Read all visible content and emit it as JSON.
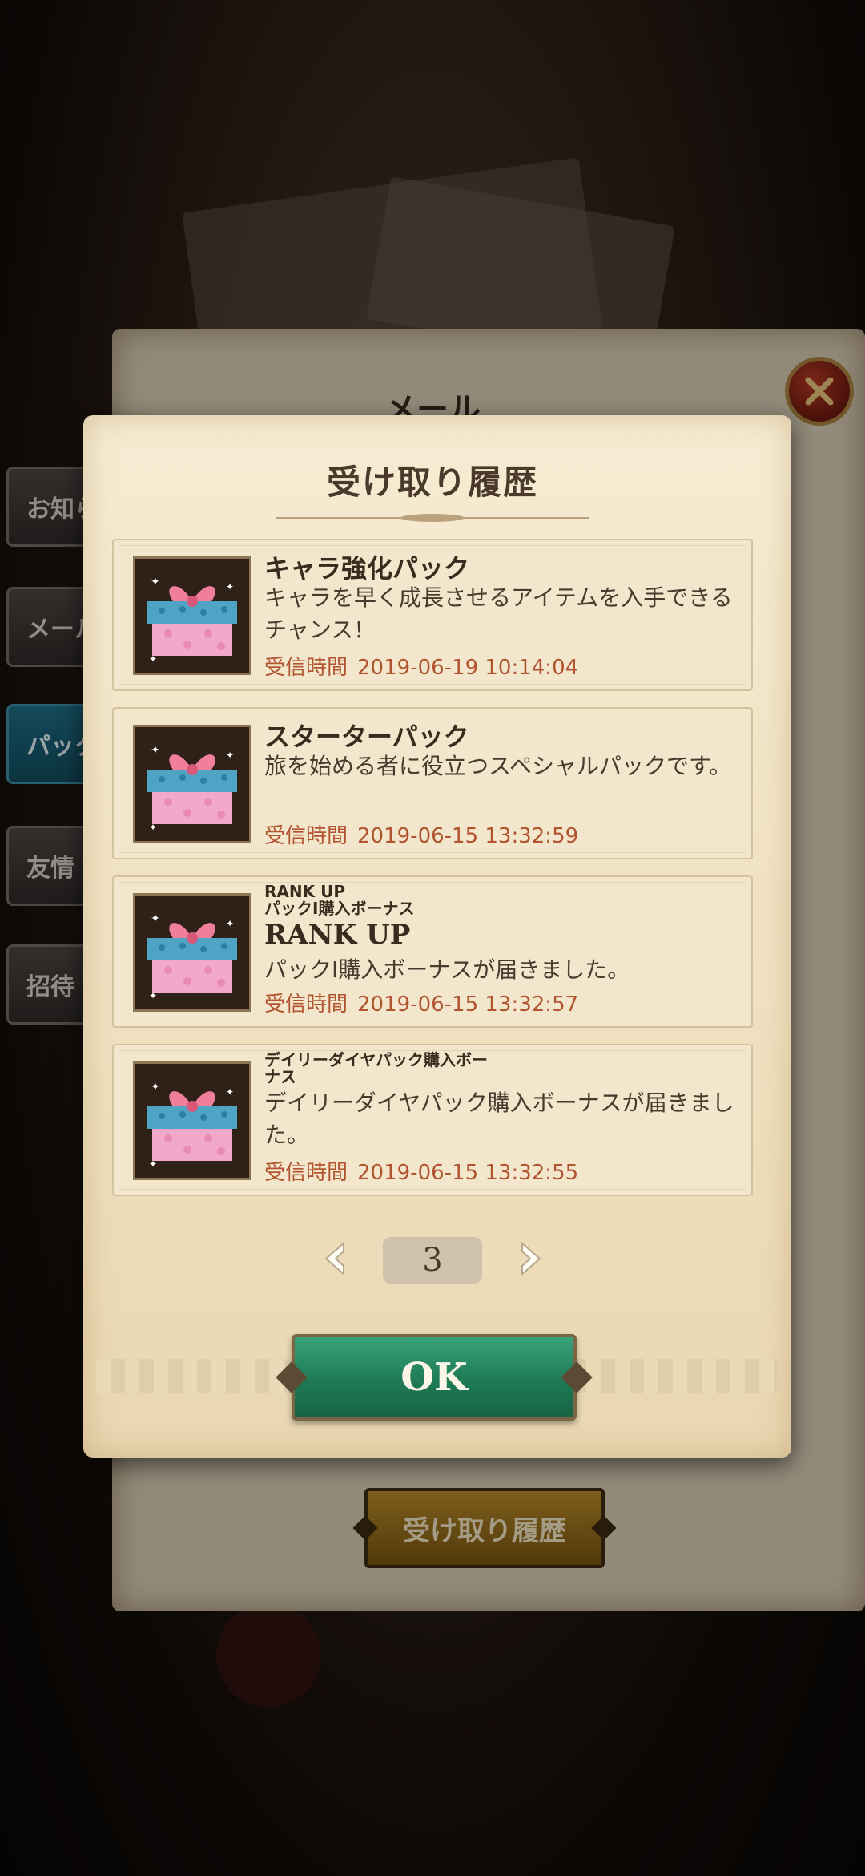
{
  "background": {
    "mail_window_title": "メール",
    "side_tabs": [
      {
        "label": "お知らせ",
        "active": false
      },
      {
        "label": "メール",
        "active": false
      },
      {
        "label": "パック",
        "active": true
      },
      {
        "label": "友情",
        "active": false
      },
      {
        "label": "招待",
        "active": false
      }
    ],
    "history_button_label": "受け取り履歴"
  },
  "modal": {
    "title": "受け取り履歴",
    "time_label": "受信時間",
    "items": [
      {
        "title": "キャラ強化パック",
        "description": "キャラを早く成長させるアイテムを入手できるチャンス！",
        "received": "2019-06-19 10:14:04",
        "icon": "gift-box-icon"
      },
      {
        "title": "スターターパック",
        "description": "旅を始める者に役立つスペシャルパックです。",
        "received": "2019-06-15 13:32:59",
        "icon": "gift-box-icon"
      },
      {
        "small_title": "RANK UP\nパックⅠ購入ボーナス",
        "big_title": "RANK UP",
        "description": "パックⅠ購入ボーナスが届きました。",
        "received": "2019-06-15 13:32:57",
        "icon": "gift-box-icon"
      },
      {
        "small_title": "デイリーダイヤパック購入ボーナス",
        "description": "デイリーダイヤパック購入ボーナスが届きました。",
        "received": "2019-06-15 13:32:55",
        "icon": "gift-box-icon"
      }
    ],
    "pager": {
      "current_page": "3",
      "prev_icon": "chevron-left-icon",
      "next_icon": "chevron-right-icon"
    },
    "ok_label": "OK"
  },
  "colors": {
    "ok_green": "#1e7a55",
    "time_orange": "#b1542f",
    "close_red": "#9b2a1a"
  }
}
